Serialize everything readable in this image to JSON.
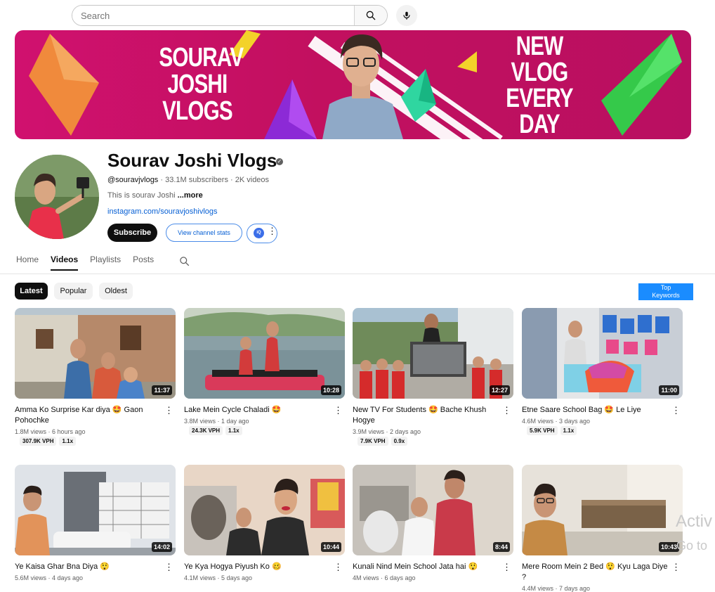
{
  "search": {
    "placeholder": "Search"
  },
  "banner": {
    "title_lines": [
      "SOURAV",
      "JOSHI",
      "VLOGS"
    ],
    "slogan_lines": [
      "NEW",
      "VLOG",
      "EVERY",
      "DAY"
    ]
  },
  "channel": {
    "name": "Sourav Joshi Vlogs",
    "handle": "@souravjvlogs",
    "stats": "· 33.1M subscribers · 2K videos",
    "description": "This is sourav Joshi",
    "more": "...more",
    "link": "instagram.com/souravjoshivlogs",
    "subscribe_label": "Subscribe",
    "stats_button_label": "View channel stats",
    "ext_label": "iQ"
  },
  "tabs": [
    "Home",
    "Videos",
    "Playlists",
    "Posts"
  ],
  "chips": [
    "Latest",
    "Popular",
    "Oldest"
  ],
  "top_keywords_label": [
    "Top",
    "Keywords"
  ],
  "videos": [
    {
      "title": "Amma Ko Surprise Kar diya 🤩 Gaon Pohochke",
      "views": "1.8M views",
      "age": "6 hours ago",
      "duration": "11:37",
      "vph": "307.9K VPH",
      "ratio": "1.1x"
    },
    {
      "title": "Lake Mein Cycle Chaladi 🤩",
      "views": "3.8M views",
      "age": "1 day ago",
      "duration": "10:28",
      "vph": "24.3K VPH",
      "ratio": "1.1x"
    },
    {
      "title": "New TV For Students 🤩 Bache Khush Hogye",
      "views": "3.9M views",
      "age": "2 days ago",
      "duration": "12:27",
      "vph": "7.9K VPH",
      "ratio": "0.9x"
    },
    {
      "title": "Etne Saare School Bag 🤩 Le Liye",
      "views": "4.6M views",
      "age": "3 days ago",
      "duration": "11:00",
      "vph": "5.9K VPH",
      "ratio": "1.1x"
    },
    {
      "title": "Ye Kaisa Ghar Bna Diya 😲",
      "views": "5.6M views",
      "age": "4 days ago",
      "duration": "14:02"
    },
    {
      "title": "Ye Kya Hogya Piyush Ko 🥴",
      "views": "4.1M views",
      "age": "5 days ago",
      "duration": "10:44"
    },
    {
      "title": "Kunali Nind Mein School Jata hai 😲",
      "views": "4M views",
      "age": "6 days ago",
      "duration": "8:44"
    },
    {
      "title": "Mere Room Mein 2 Bed 😲 Kyu Laga Diye ?",
      "views": "4.4M views",
      "age": "7 days ago",
      "duration": "10:43"
    }
  ],
  "watermark": {
    "line1": "Activ",
    "line2": "Go to"
  }
}
